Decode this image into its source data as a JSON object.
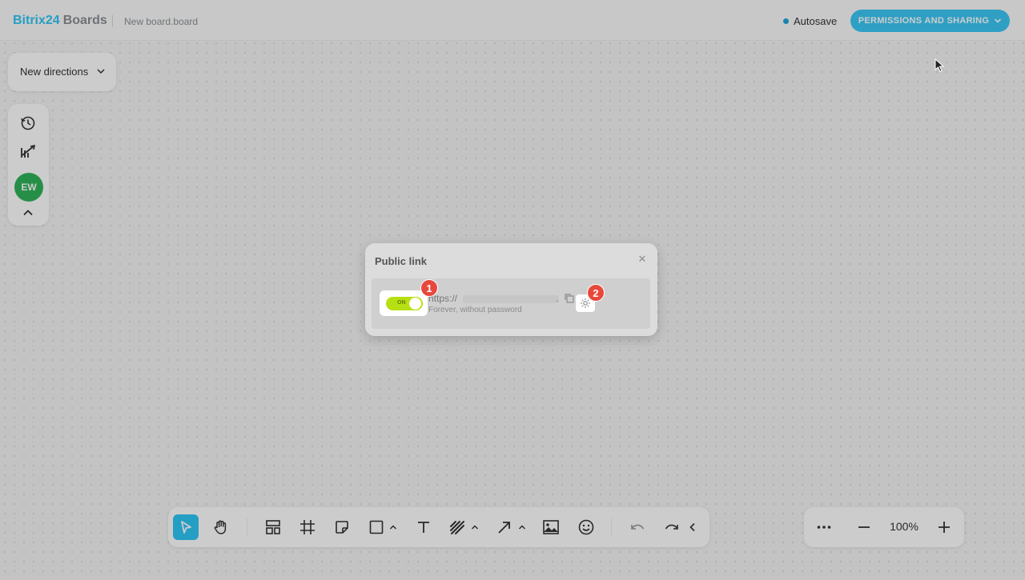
{
  "header": {
    "logo_bitrix": "Bitrix",
    "logo_24": "24",
    "logo_boards": "Boards",
    "board_name": "New board.board",
    "autosave": "Autosave",
    "permissions_button": "PERMISSIONS AND SHARING"
  },
  "directions": {
    "label": "New directions"
  },
  "sidebar": {
    "items": [
      {
        "icon": "history-icon"
      },
      {
        "icon": "tools-off-icon"
      },
      {
        "icon": "avatar",
        "initials": "EW"
      },
      {
        "icon": "chevron-up-icon"
      }
    ]
  },
  "toolbar": {
    "tools": [
      "select-icon",
      "hand-icon",
      "layout-icon",
      "frame-icon",
      "sticky-note-icon",
      "shape-icon",
      "text-icon",
      "pen-icon",
      "arrow-icon",
      "image-icon",
      "emoji-icon",
      "undo-icon",
      "redo-icon",
      "collapse-icon"
    ]
  },
  "zoom": {
    "value": "100%"
  },
  "modal": {
    "title": "Public link",
    "toggle_label": "ON",
    "url": "https://",
    "url_tail": ".",
    "subtext": "Forever, without password",
    "badge_1": "1",
    "badge_2": "2"
  },
  "colors": {
    "accent": "#2fc6f6",
    "toggle_on": "#b6e013",
    "badge": "#e8483b",
    "avatar": "#2fb35a"
  }
}
